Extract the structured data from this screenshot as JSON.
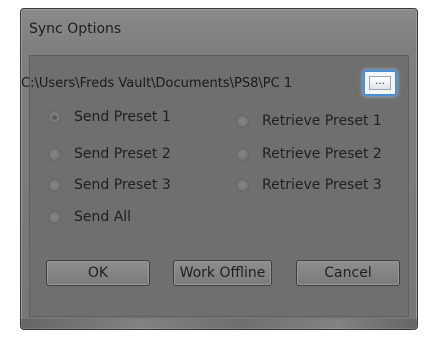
{
  "window": {
    "title": "Sync Options"
  },
  "path": {
    "value": "C:\\Users\\Freds Vault\\Documents\\PS8\\PC 1"
  },
  "browse": {
    "label": "..."
  },
  "options": {
    "send_preset_1": "Send Preset 1",
    "send_preset_2": "Send Preset 2",
    "send_preset_3": "Send Preset 3",
    "send_all": "Send All",
    "retrieve_preset_1": "Retrieve Preset 1",
    "retrieve_preset_2": "Retrieve Preset 2",
    "retrieve_preset_3": "Retrieve Preset 3",
    "selected": "send_preset_1"
  },
  "buttons": {
    "ok": "OK",
    "work_offline": "Work Offline",
    "cancel": "Cancel"
  }
}
